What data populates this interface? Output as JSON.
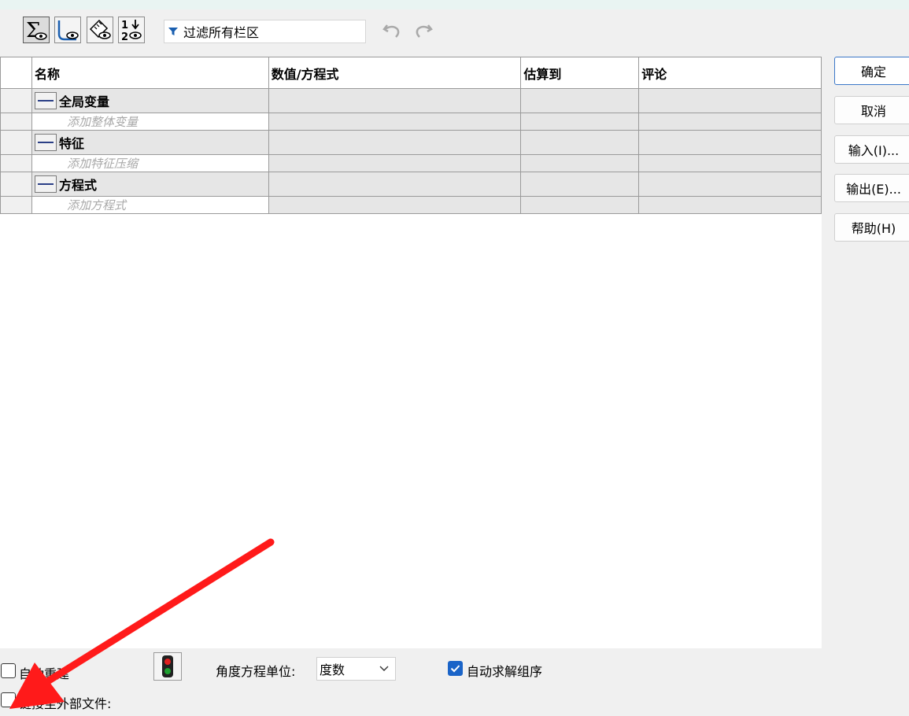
{
  "toolbar": {
    "buttons": [
      {
        "icon": "sigma-eye-icon"
      },
      {
        "icon": "curve-eye-icon"
      },
      {
        "icon": "ruler-eye-icon"
      },
      {
        "icon": "sort-order-eye-icon"
      }
    ],
    "filter_placeholder": "过滤所有栏区",
    "undo_icon": "undo-icon",
    "redo_icon": "redo-icon"
  },
  "table": {
    "columns": [
      "名称",
      "数值/方程式",
      "估算到",
      "评论"
    ],
    "groups": [
      {
        "name": "全局变量",
        "placeholder": "添加整体变量"
      },
      {
        "name": "特征",
        "placeholder": "添加特征压缩"
      },
      {
        "name": "方程式",
        "placeholder": "添加方程式"
      }
    ]
  },
  "side_buttons": {
    "ok": "确定",
    "cancel": "取消",
    "import": "输入(I)...",
    "export": "输出(E)...",
    "help": "帮助(H)"
  },
  "bottom": {
    "auto_rebuild": {
      "label": "自动重建",
      "checked": false
    },
    "link_external": {
      "label": "链接至外部文件:",
      "checked": false
    },
    "traffic_icon": "traffic-light-icon",
    "angle_unit_label": "角度方程单位:",
    "angle_unit_value": "度数",
    "auto_solve": {
      "label": "自动求解组序",
      "checked": true
    }
  },
  "colors": {
    "accent": "#1a64c8",
    "annotation_arrow": "#ff1a1a"
  }
}
